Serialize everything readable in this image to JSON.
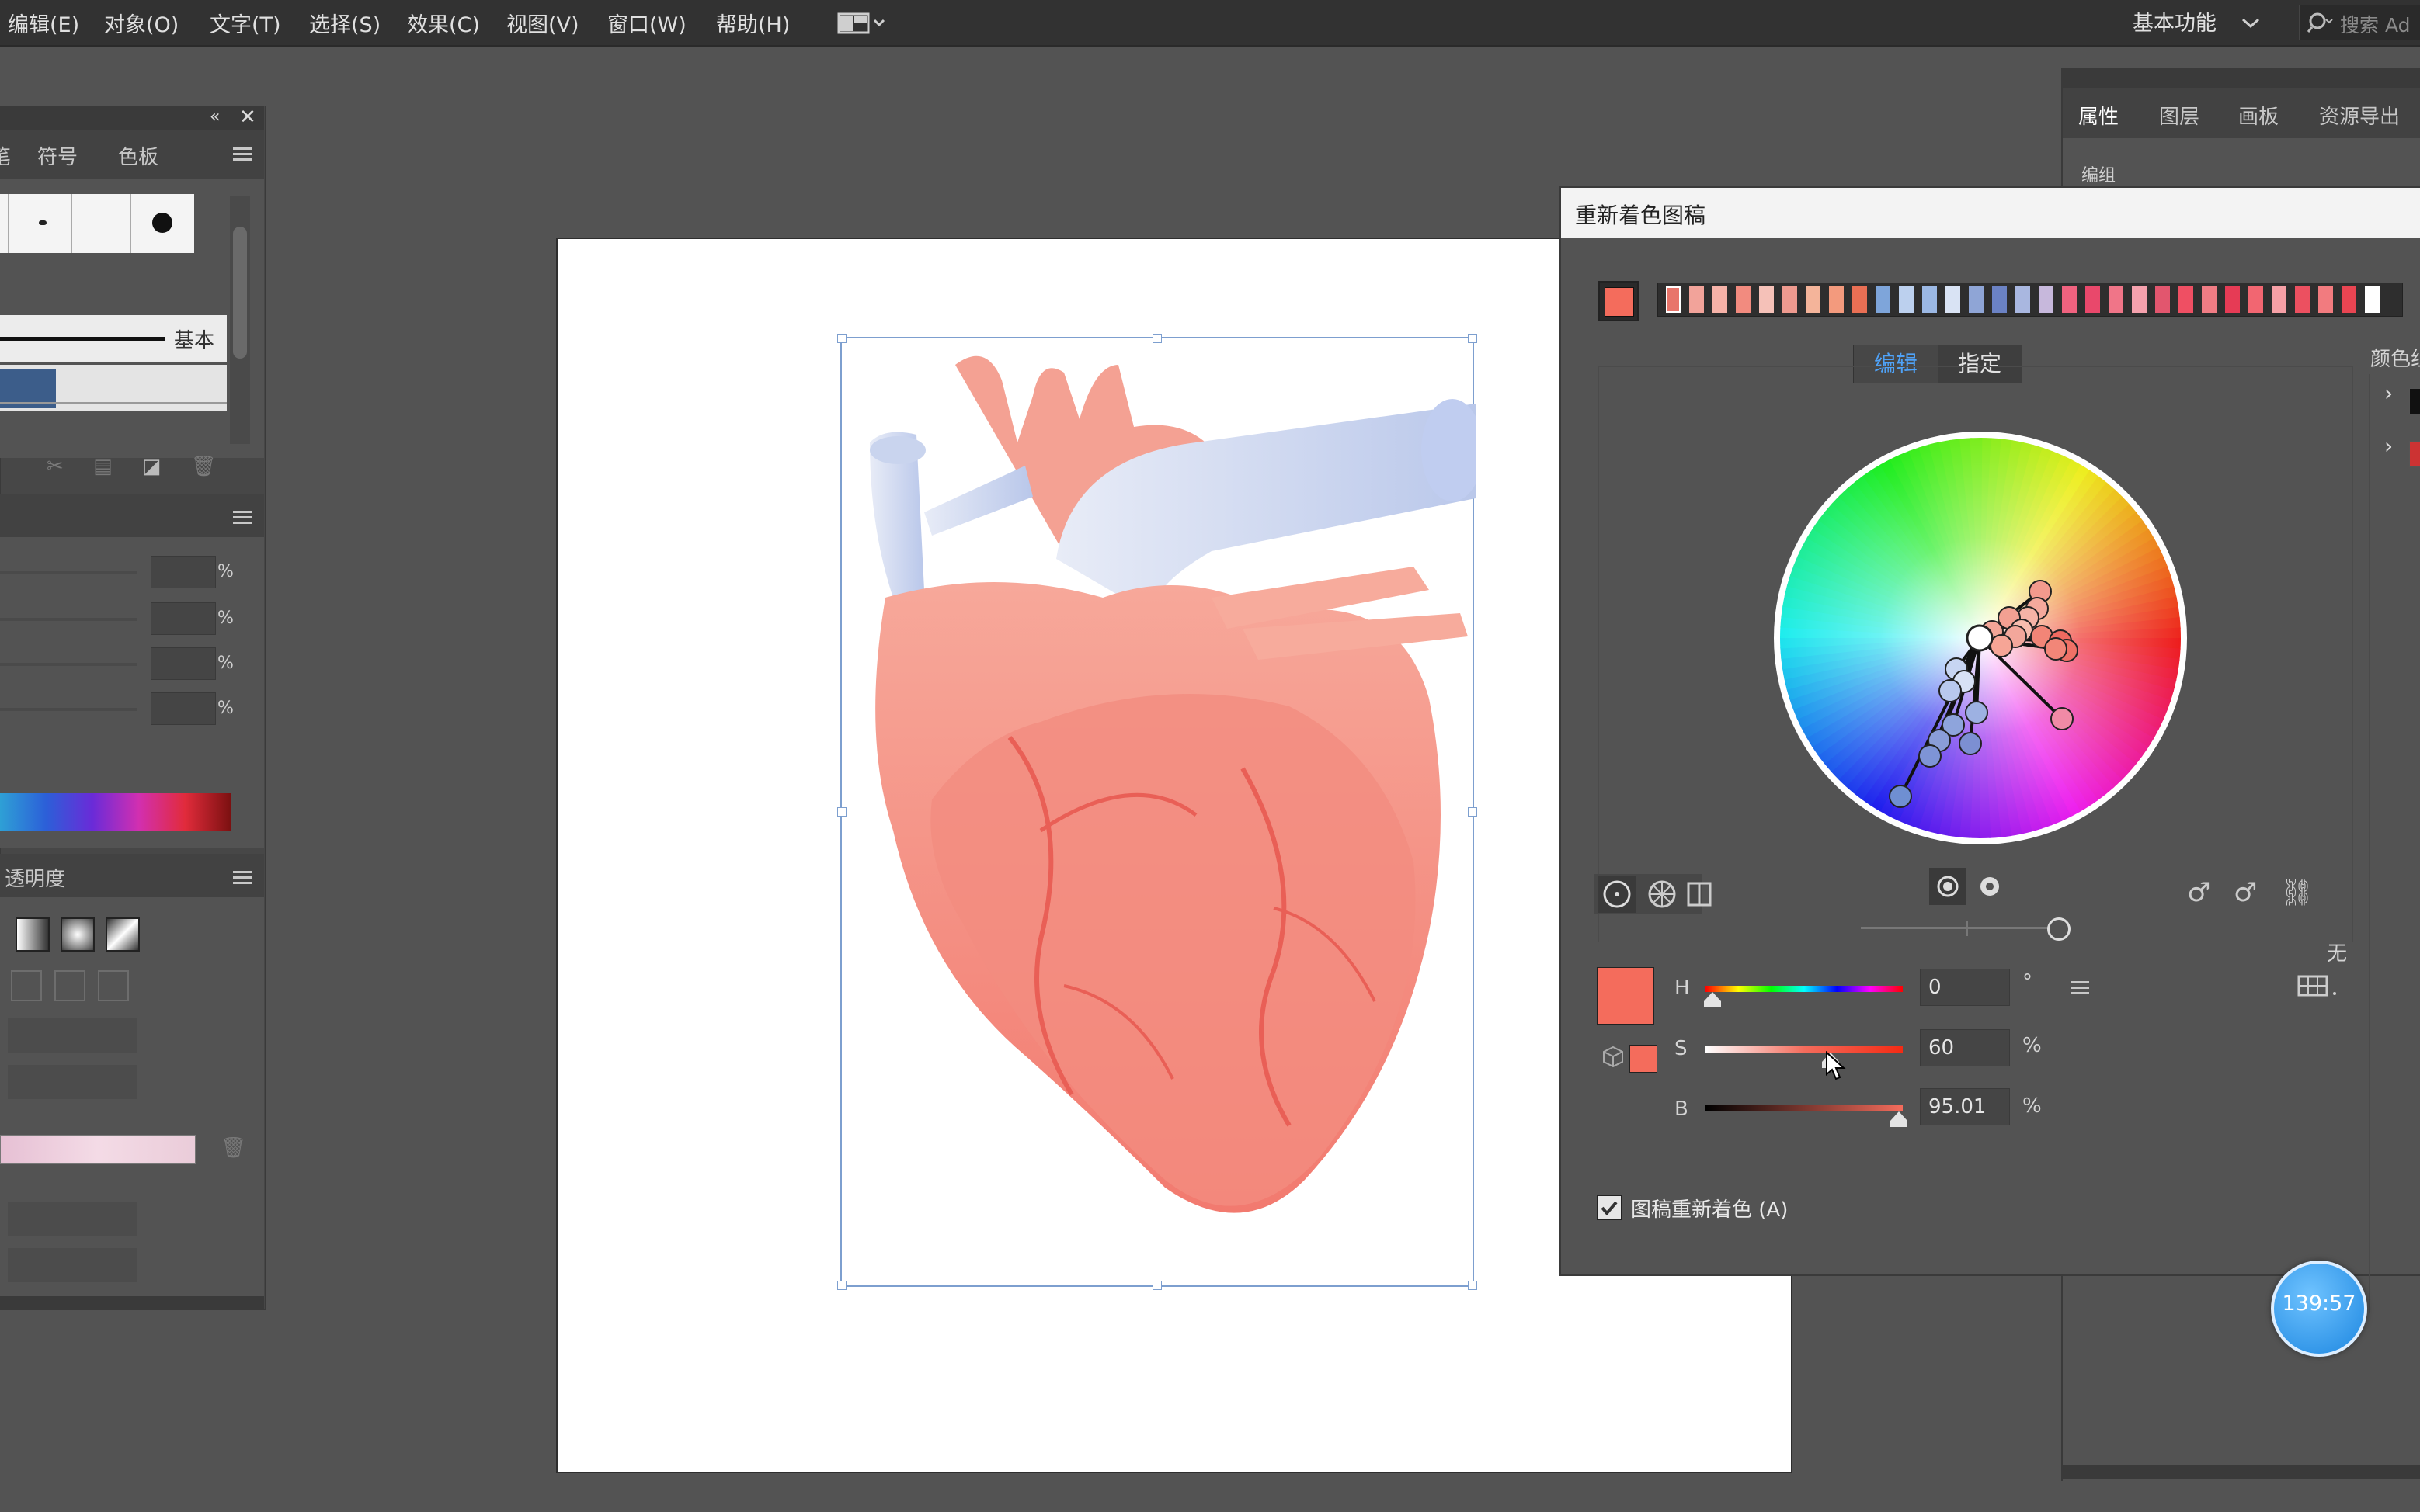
{
  "menu": {
    "edit": "编辑(E)",
    "object": "对象(O)",
    "type": "文字(T)",
    "select": "选择(S)",
    "effect": "效果(C)",
    "view": "视图(V)",
    "window": "窗口(W)",
    "help": "帮助(H)",
    "workspace": "基本功能",
    "search_placeholder": "搜索 Ad"
  },
  "brushes_panel": {
    "tabs": [
      "笔",
      "符号",
      "色板"
    ],
    "brush_label": "基本"
  },
  "transparency_panel": {
    "title": "透明度",
    "pct": [
      "%",
      "%",
      "%",
      "%"
    ]
  },
  "props_panel": {
    "tabs": [
      "属性",
      "图层",
      "画板",
      "资源导出"
    ],
    "group_label": "编组"
  },
  "recolor": {
    "title": "重新着色图稿",
    "mode_edit": "编辑",
    "mode_assign": "指定",
    "color_groups_label": "颜色组",
    "none_label": "无",
    "h_label": "H",
    "s_label": "S",
    "b_label": "B",
    "h_value": "0",
    "s_value": "60",
    "b_value": "95.01",
    "h_unit": "°",
    "s_unit": "%",
    "b_unit": "%",
    "recolor_checkbox_label": "图稿重新着色 (A)",
    "recolor_checked": true,
    "active_color": "#f46c5c",
    "palette": [
      "#e8756b",
      "#f2a39a",
      "#f6b2a8",
      "#f28b7f",
      "#f5c1b8",
      "#ee9a8f",
      "#f4b49a",
      "#f39a7d",
      "#e96f54",
      "#7ea5da",
      "#bcd0ee",
      "#9bb8e4",
      "#d9e3f4",
      "#8fa5d6",
      "#6b82c4",
      "#a9b7e0",
      "#c7b8dc",
      "#f0627f",
      "#e9486b",
      "#f07588",
      "#f5a1ad",
      "#e2566e",
      "#ef4f63",
      "#f07c84",
      "#e63b55",
      "#f26671",
      "#f6a0a6",
      "#ec5060",
      "#f27b7f",
      "#e94552",
      "#ffffff"
    ]
  },
  "timer": {
    "label": "139:57"
  }
}
